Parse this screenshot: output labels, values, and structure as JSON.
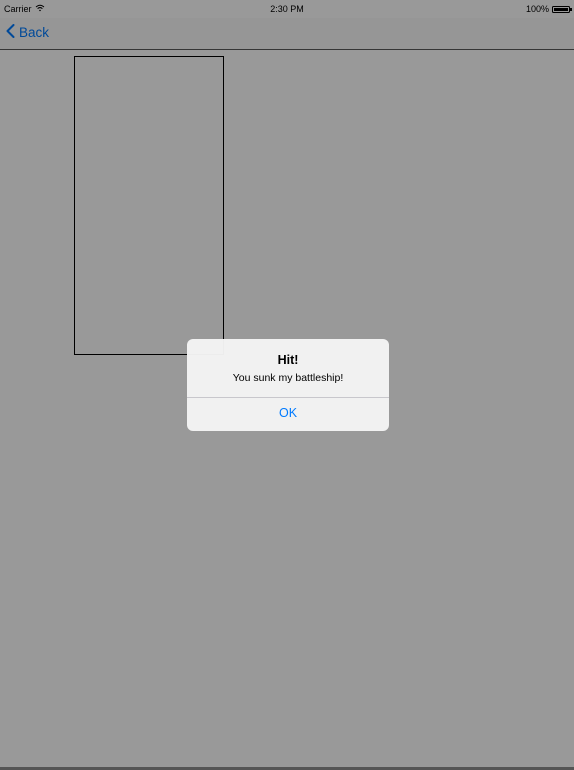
{
  "status_bar": {
    "carrier": "Carrier",
    "time": "2:30 PM",
    "battery_percent": "100%",
    "battery_level": 1.0,
    "wifi_icon": "wifi-icon",
    "battery_icon": "battery-icon"
  },
  "nav_bar": {
    "back_label": "Back",
    "back_icon": "chevron-left-icon"
  },
  "alert": {
    "title": "Hit!",
    "message": "You sunk my battleship!",
    "button_label": "OK"
  },
  "colors": {
    "accent": "#007aff",
    "dim_overlay": "rgba(0,0,0,0.4)",
    "alert_background": "#f4f4f4"
  }
}
